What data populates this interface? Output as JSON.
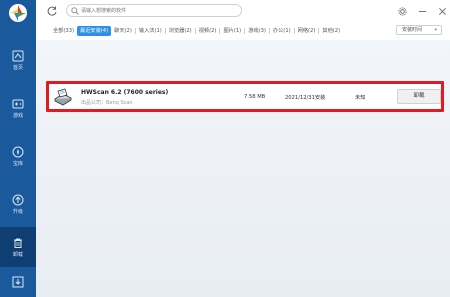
{
  "sidebar": {
    "items": [
      {
        "label": "首页",
        "icon": "home-icon"
      },
      {
        "label": "游戏",
        "icon": "gamepad-icon"
      },
      {
        "label": "宝库",
        "icon": "treasure-icon"
      },
      {
        "label": "升级",
        "icon": "upgrade-icon"
      },
      {
        "label": "卸载",
        "icon": "trash-icon",
        "active": true
      }
    ]
  },
  "search": {
    "placeholder": "请输入想搜索的软件"
  },
  "tabs": [
    {
      "label": "全部(33)"
    },
    {
      "label": "最近安装(4)",
      "active": true
    },
    {
      "label": "聊天(2)"
    },
    {
      "label": "输入法(1)"
    },
    {
      "label": "浏览器(2)"
    },
    {
      "label": "视频(2)"
    },
    {
      "label": "图片(1)"
    },
    {
      "label": "游戏(3)"
    },
    {
      "label": "办公(1)"
    },
    {
      "label": "网络(2)"
    },
    {
      "label": "其他(2)"
    }
  ],
  "sort": {
    "label": "安装时间"
  },
  "software": {
    "name": "HWScan 6.2 (7600 series)",
    "publisher": "出品公司：Benq Scan",
    "size": "7.58 MB",
    "date": "2021/12/31安装",
    "usage": "未知",
    "uninstall_label": "卸载"
  },
  "colors": {
    "sidebar": "#1a5a9c",
    "accent": "#2e8fe6",
    "highlight_border": "#e11b22"
  }
}
